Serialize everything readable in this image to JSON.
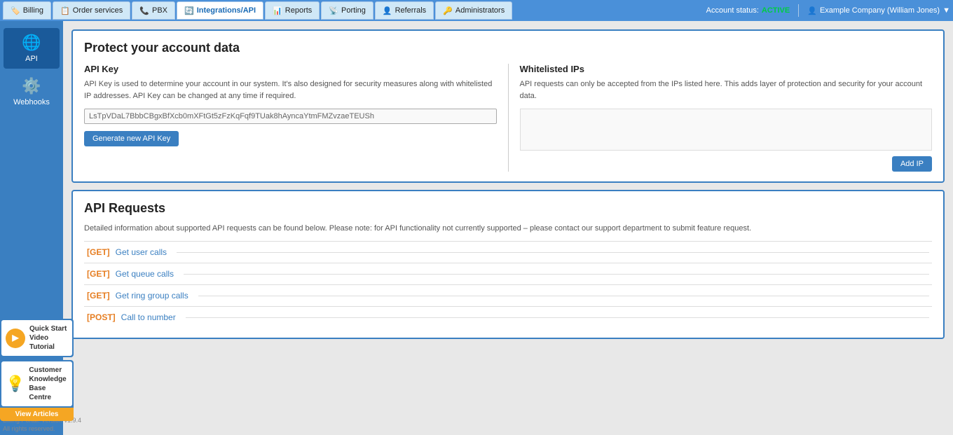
{
  "topNav": {
    "tabs": [
      {
        "id": "billing",
        "label": "Billing",
        "icon": "🏷️",
        "active": false
      },
      {
        "id": "order-services",
        "label": "Order services",
        "icon": "📋",
        "active": false
      },
      {
        "id": "pbx",
        "label": "PBX",
        "icon": "📞",
        "active": false
      },
      {
        "id": "integrations-api",
        "label": "Integrations/API",
        "icon": "🔄",
        "active": true
      },
      {
        "id": "reports",
        "label": "Reports",
        "icon": "📊",
        "active": false
      },
      {
        "id": "porting",
        "label": "Porting",
        "icon": "📡",
        "active": false
      },
      {
        "id": "referrals",
        "label": "Referrals",
        "icon": "👤",
        "active": false
      },
      {
        "id": "administrators",
        "label": "Administrators",
        "icon": "🔑",
        "active": false
      }
    ],
    "accountStatusLabel": "Account status:",
    "accountStatusValue": "ACTIVE",
    "userInfo": "Example Company (William Jones)"
  },
  "sidebar": {
    "items": [
      {
        "id": "api",
        "label": "API",
        "icon": "🌐",
        "active": true
      },
      {
        "id": "webhooks",
        "label": "Webhooks",
        "icon": "⚙️",
        "active": false
      }
    ]
  },
  "protectCard": {
    "title": "Protect your account data",
    "apiKey": {
      "sectionTitle": "API Key",
      "description": "API Key is used to determine your account in our system. It's also designed for security measures along with whitelisted IP addresses. API Key can be changed at any time if required.",
      "keyValue": "LsTpVDaL7BbbCBgxBfXcb0mXFtGt5zFzKqFqf9TUak8hAyncaYtmFMZvzaeTEUSh",
      "generateButtonLabel": "Generate new API Key"
    },
    "whitelistedIPs": {
      "sectionTitle": "Whitelisted IPs",
      "description": "API requests can only be accepted from the IPs listed here. This adds layer of protection and security for your account data.",
      "addButtonLabel": "Add IP"
    }
  },
  "apiRequests": {
    "title": "API Requests",
    "description": "Detailed information about supported API requests can be found below. Please note: for API functionality not currently supported – please contact our support department to submit feature request.",
    "items": [
      {
        "method": "[GET]",
        "label": "Get user calls"
      },
      {
        "method": "[GET]",
        "label": "Get queue calls"
      },
      {
        "method": "[GET]",
        "label": "Get ring group calls"
      },
      {
        "method": "[POST]",
        "label": "Call to number"
      }
    ]
  },
  "widgets": {
    "quickStart": {
      "title": "Quick Start Video Tutorial",
      "buttonLabel": "▶"
    },
    "knowledgeBase": {
      "title": "Customer Knowledge Base Centre",
      "buttonLabel": "View Articles"
    }
  },
  "footer": {
    "line1": "Billing Portal. Version v1.9.4",
    "line2": "All rights reserved."
  }
}
